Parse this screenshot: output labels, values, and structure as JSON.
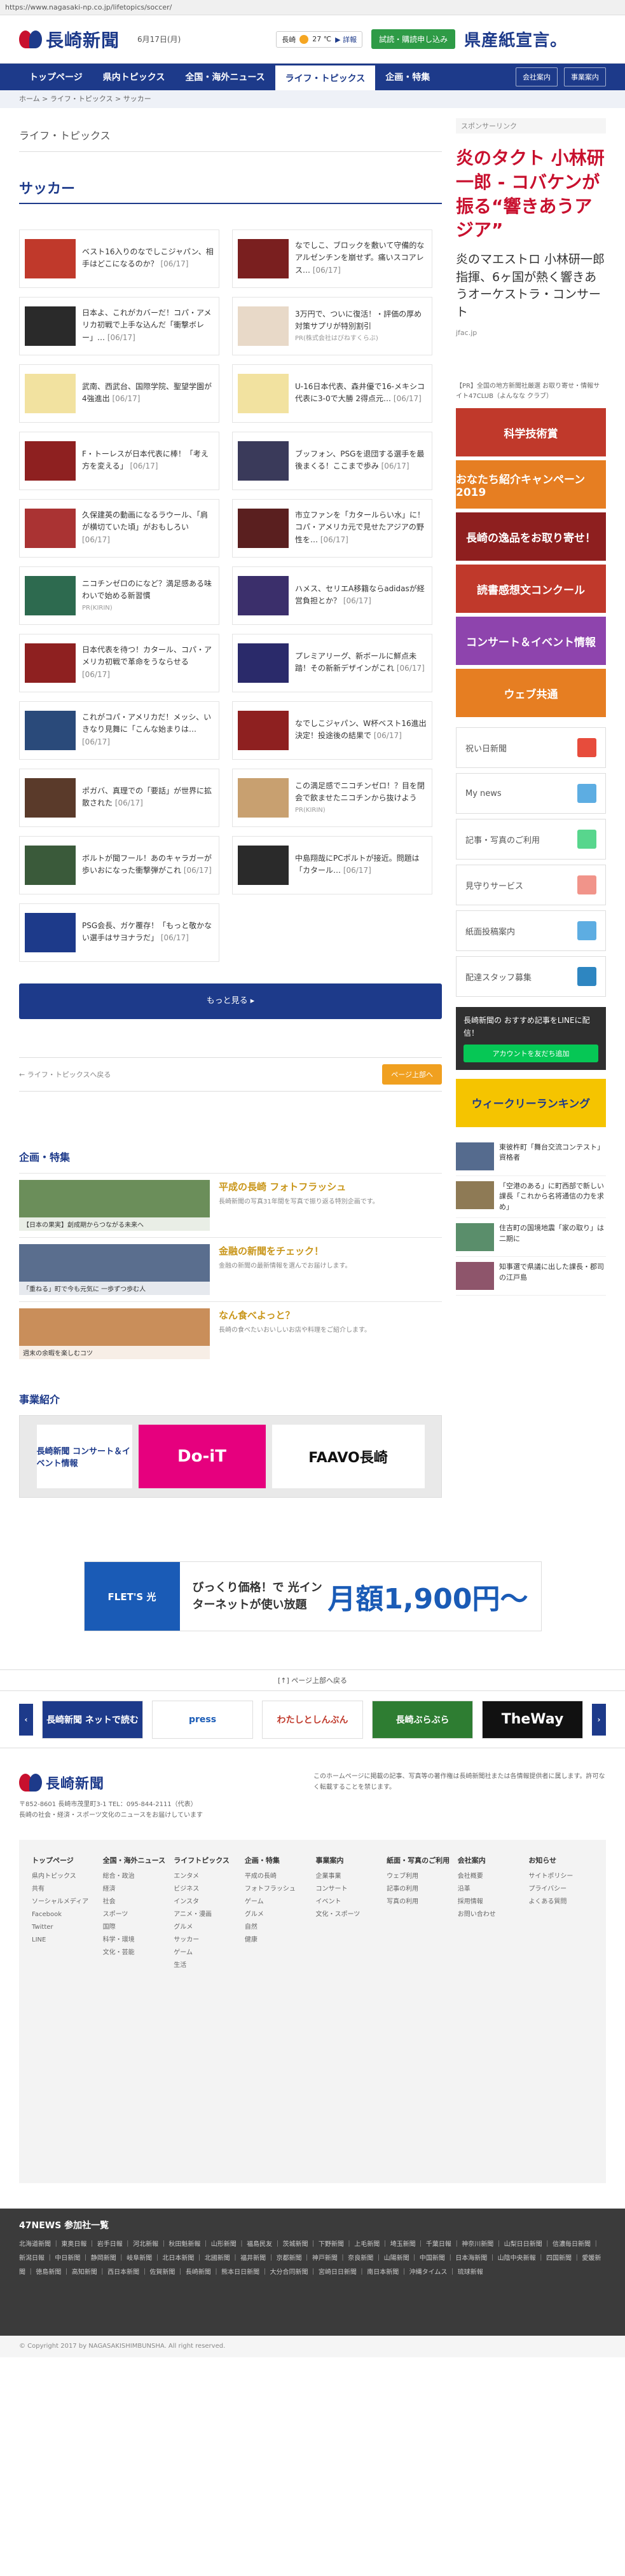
{
  "url": "https://www.nagasaki-np.co.jp/lifetopics/soccer/",
  "site": {
    "name": "長崎新聞",
    "date": "6月17日(月)"
  },
  "weather": {
    "city": "長崎",
    "temp": "27 ℃",
    "link": "▶ 詳報"
  },
  "header": {
    "trial": "試読・購読申し込み",
    "paper": "県産紙宣言。"
  },
  "nav": {
    "items": [
      "トップページ",
      "県内トピックス",
      "全国・海外ニュース",
      "ライフ・トピックス",
      "企画・特集"
    ],
    "right": [
      "会社案内",
      "事業案内"
    ]
  },
  "breadcrumb": "ホーム > ライフ・トピックス > サッカー",
  "section": "ライフ・トピックス",
  "title": "サッカー",
  "articles": [
    {
      "text": "ベスト16入りのなでしこジャパン、相手はどこになるのか？",
      "date": "[06/17]",
      "src": "",
      "color": "#c0392b"
    },
    {
      "text": "なでしこ、ブロックを敷いて守備的なアルゼンチンを崩せず。痛いスコアレス…",
      "date": "[06/17]",
      "src": "",
      "color": "#7a1f1f"
    },
    {
      "text": "日本よ、これがカバーだ！コパ・アメリカ初戦で上手な込んだ「衝撃ボレー」…",
      "date": "[06/17]",
      "src": "",
      "color": "#2a2a2a"
    },
    {
      "text": "3万円で、ついに復活！・評価の厚め対策サプリが特別割引",
      "date": "",
      "src": "PR(株式会社はぴねすくらぶ)",
      "color": "#e8d9c8"
    },
    {
      "text": "武南、西武台、国際学院、聖望学園が4強進出",
      "date": "[06/17]",
      "src": "",
      "color": "#f2e2a0"
    },
    {
      "text": "U-16日本代表、森井優で16-メキシコ代表に3-0で大勝 2得点元…",
      "date": "[06/17]",
      "src": "",
      "color": "#f2e2a0"
    },
    {
      "text": "F・トーレスが日本代表に棒！「考え方を変える」",
      "date": "[06/17]",
      "src": "",
      "color": "#8e2020"
    },
    {
      "text": "ブッフォン、PSGを退団する選手を最後まくる！ここまで歩み",
      "date": "[06/17]",
      "src": "",
      "color": "#3a3a5a"
    },
    {
      "text": "久保建英の動画になるラウール、「肩が横切ていた頃」がおもしろい",
      "date": "[06/17]",
      "src": "",
      "color": "#a33"
    },
    {
      "text": "市立ファンを「カタールらい水」に！コパ・アメリカ元で見せたアジアの野性を…",
      "date": "[06/17]",
      "src": "",
      "color": "#5a1f1f"
    },
    {
      "text": "ニコチンゼロのになど？満足感ある味わいで始める新習慣",
      "date": "",
      "src": "PR(KIRIN)",
      "color": "#2d6a4f"
    },
    {
      "text": "ハメス、セリエA移籍ならadidasが経営負担とか？",
      "date": "[06/17]",
      "src": "",
      "color": "#3b2f6b"
    },
    {
      "text": "日本代表を待つ！カタール、コパ・アメリカ初戦で革命をうならせる",
      "date": "[06/17]",
      "src": "",
      "color": "#8e2020"
    },
    {
      "text": "プレミアリーグ、新ボールに鮮点未踏！その新新デザインがこれ",
      "date": "[06/17]",
      "src": "",
      "color": "#2a2a6a"
    },
    {
      "text": "これがコパ・アメリカだ！メッシ、いきなり見舞に「こんな始まりは…",
      "date": "[06/17]",
      "src": "",
      "color": "#2a4a7a"
    },
    {
      "text": "なでしこジャパン、W杯ベスト16進出決定！投途後の結果で",
      "date": "[06/17]",
      "src": "",
      "color": "#8e2020"
    },
    {
      "text": "ポガバ、真理での「要話」が世界に拡散された",
      "date": "[06/17]",
      "src": "",
      "color": "#5a3a2a"
    },
    {
      "text": "この満足感でニコチンゼロ！？目を閉会で飲ませたニコチンから抜けよう",
      "date": "",
      "src": "PR(KIRIN)",
      "color": "#c8a070"
    },
    {
      "text": "ボルトが聞フール！あのキャラガーが歩いおになった衝撃弾がこれ",
      "date": "[06/17]",
      "src": "",
      "color": "#3a5a3a"
    },
    {
      "text": "中島翔哉にPCポルトが接近。問題は「カタール…",
      "date": "[06/17]",
      "src": "",
      "color": "#2a2a2a"
    },
    {
      "text": "PSG会長、ガケ覆存！「もっと敬かない選手はサヨナラだ」",
      "date": "[06/17]",
      "src": "",
      "color": "#1d3a8a"
    }
  ],
  "more": "もっと見る ▸",
  "pager": {
    "back": "← ライフ・トピックスへ戻る",
    "top": "ページ上部へ"
  },
  "features_title": "企画・特集",
  "features": [
    {
      "cap": "【日本の果実】創成期からつながる未来へ",
      "title": "平成の長崎 フォトフラッシュ",
      "desc": "長崎新聞の写真31年間を写真で振り返る特別企画です。",
      "color": "#6b8e5a"
    },
    {
      "cap": "「重ねる」町で今も元気に 一歩ずつ歩む人",
      "title": "金融の新聞をチェック！",
      "desc": "金融の新聞の最新情報を選んでお届けします。",
      "color": "#5a6e8e"
    },
    {
      "cap": "週末の余暇を楽しむコツ",
      "title": "なん食べよっと？",
      "desc": "長崎の食べたいおいしいお店や料理をご紹介します。",
      "color": "#c98e5a"
    }
  ],
  "business_title": "事業紹介",
  "business": [
    "長崎新聞 コンサート＆イベント情報",
    "Do-iT",
    "FAAVO長崎"
  ],
  "sidebar": {
    "sponsor_label": "スポンサーリンク",
    "ad_text": "炎のタクト 小林研一郎 - コバケンが振る“響きあうアジア”",
    "ad_sub": "炎のマエストロ 小林研一郎指揮、6ヶ国が熱く響きあうオーケストラ・コンサート",
    "ad_url": "jfac.jp",
    "note": "【PR】全国の地方新聞社厳選 お取り寄せ・情報サイト47CLUB（よんなな クラブ）",
    "banners": [
      {
        "text": "科学技術賞",
        "color": "#c0392b"
      },
      {
        "text": "おなたち紹介キャンペーン 2019",
        "color": "#e67e22"
      },
      {
        "text": "長崎の逸品をお取り寄せ！",
        "color": "#8e1f1f"
      },
      {
        "text": "読書感想文コンクール",
        "color": "#c0392b"
      },
      {
        "text": "コンサート＆イベント情報",
        "color": "#8e44ad"
      },
      {
        "text": "ウェブ共通",
        "color": "#e67e22"
      }
    ],
    "buttons": [
      {
        "label": "祝い日新聞",
        "color": "#e74c3c"
      },
      {
        "label": "My news",
        "color": "#5dade2"
      },
      {
        "label": "記事・写真のご利用",
        "color": "#58d68d"
      },
      {
        "label": "見守りサービス",
        "color": "#f1948a"
      },
      {
        "label": "紙面投稿案内",
        "color": "#5dade2"
      },
      {
        "label": "配達スタッフ募集",
        "color": "#2e86c1"
      }
    ],
    "line_text": "長崎新聞の おすすめ記事をLINEに配信！",
    "line_btn": "アカウントを友だち追加",
    "ranking_text": "ウィークリーランキング",
    "ranking": [
      "東彼杵町「舞台交流コンテスト」資格者",
      "「空港のある」に町西部で新しい課長「これから名将通信の力を求め」",
      "住吉町の国境地震「家の取り」は二期に",
      "知事選で県議に出した課長・郡司の江戸島"
    ]
  },
  "flets": {
    "logo": "FLET'S 光",
    "copy": "びっくり価格！で 光インターネットが使い放題",
    "price": "月額1,900円〜"
  },
  "pagetop": "[↑] ページ上部へ戻る",
  "partners": [
    "長崎新聞 ネットで読む",
    "press",
    "わたしとしんぶん",
    "長崎ぶらぶら",
    "TheWay"
  ],
  "footer": {
    "addr": "〒852-8601 長崎市茂里町3-1 TEL：095-844-2111（代表）",
    "tag": "長崎の社会・経済・スポーツ文化のニュースをお届けしています",
    "notice": "このホームページに掲載の記事、写真等の著作権は長崎新聞社または各情報提供者に属します。許可なく転載することを禁じます。",
    "cols": [
      {
        "h": "トップページ",
        "items": [
          "県内トピックス",
          "共有",
          "ソーシャルメディア",
          "Facebook",
          "Twitter",
          "LINE"
        ]
      },
      {
        "h": "全国・海外ニュース",
        "items": [
          "総合・政治",
          "経済",
          "社会",
          "スポーツ",
          "国際",
          "科学・環境",
          "文化・芸能"
        ]
      },
      {
        "h": "ライフトピックス",
        "items": [
          "エンタメ",
          "ビジネス",
          "インスタ",
          "アニメ・漫画",
          "グルメ",
          "サッカー",
          "ゲーム",
          "生活"
        ]
      },
      {
        "h": "企画・特集",
        "items": [
          "平成の長崎",
          "フォトフラッシュ",
          "ゲーム",
          "グルメ",
          "自然",
          "健康"
        ]
      },
      {
        "h": "事業案内",
        "items": [
          "企業事業",
          "コンサート",
          "イベント",
          "文化・スポーツ"
        ]
      },
      {
        "h": "紙面・写真のご利用",
        "items": [
          "ウェブ利用",
          "記事の利用",
          "写真の利用"
        ]
      },
      {
        "h": "会社案内",
        "items": [
          "会社概要",
          "沿革",
          "採用情報",
          "お問い合わせ"
        ]
      },
      {
        "h": "お知らせ",
        "items": [
          "サイトポリシー",
          "プライバシー",
          "よくある質問"
        ]
      }
    ],
    "news47_title": "47NEWS 参加社一覧",
    "news47_list": "北海道新聞 ｜ 東奥日報 ｜ 岩手日報 ｜ 河北新報 ｜ 秋田魁新報 ｜ 山形新聞 ｜ 福島民友 ｜ 茨城新聞 ｜ 下野新聞 ｜ 上毛新聞 ｜ 埼玉新聞 ｜ 千葉日報 ｜ 神奈川新聞 ｜ 山梨日日新聞 ｜ 信濃毎日新聞 ｜ 新潟日報 ｜ 中日新聞 ｜ 静岡新聞 ｜ 岐阜新聞 ｜ 北日本新聞 ｜ 北國新聞 ｜ 福井新聞 ｜ 京都新聞 ｜ 神戸新聞 ｜ 奈良新聞 ｜ 山陽新聞 ｜ 中国新聞 ｜ 日本海新聞 ｜ 山陰中央新報 ｜ 四国新聞 ｜ 愛媛新聞 ｜ 徳島新聞 ｜ 高知新聞 ｜ 西日本新聞 ｜ 佐賀新聞 ｜ 長崎新聞 ｜ 熊本日日新聞 ｜ 大分合同新聞 ｜ 宮崎日日新聞 ｜ 南日本新聞 ｜ 沖縄タイムス ｜ 琉球新報",
    "copyright": "© Copyright 2017 by NAGASAKISHIMBUNSHA. All right reserved."
  }
}
